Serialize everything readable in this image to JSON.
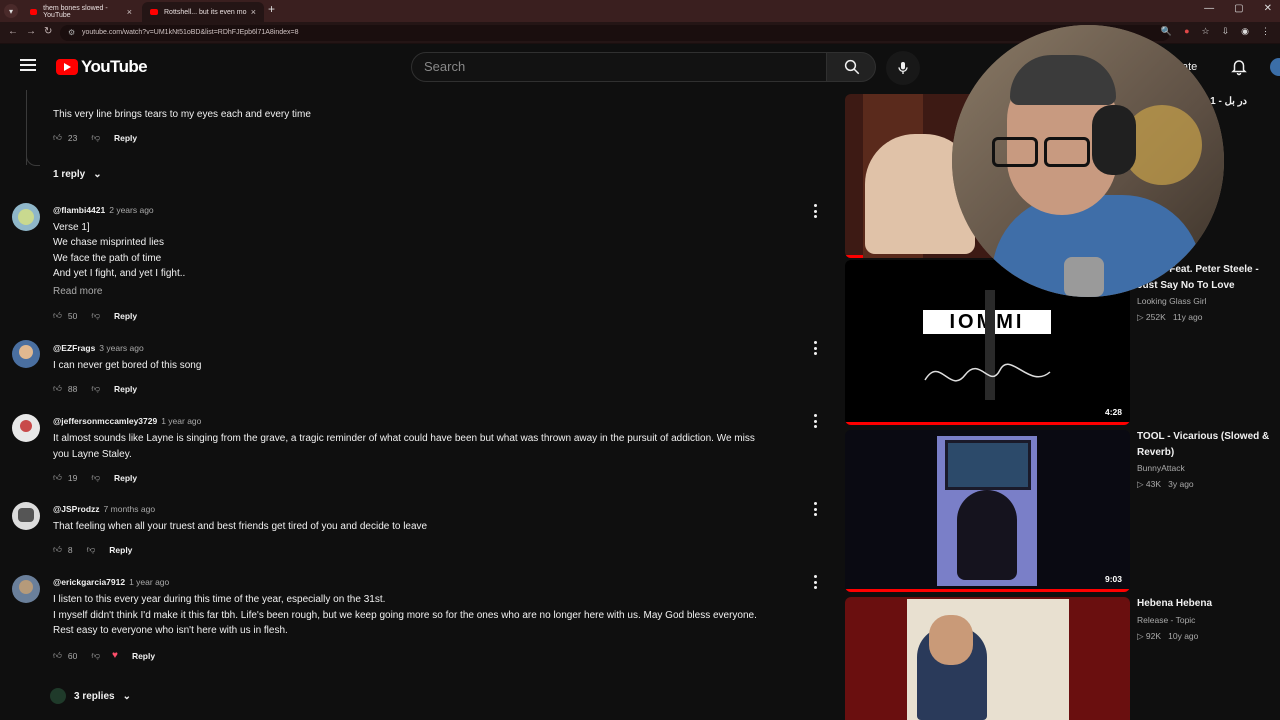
{
  "browser": {
    "tabs": [
      {
        "label": "them bones slowed - YouTube"
      },
      {
        "label": "Rottshell... but its even mo"
      }
    ],
    "url": "youtube.com/watch?v=UM1kNt51oBD&list=RDhFJEpb6l71A8index=8"
  },
  "header": {
    "logo_text": "YouTube",
    "search_placeholder": "Search",
    "create_label": "ate"
  },
  "comments": {
    "top_snippet": {
      "text": "This very line brings tears to my eyes each and every time",
      "likes": "23",
      "reply": "Reply",
      "replies_toggle": "1 reply"
    },
    "items": [
      {
        "author": "@flambi4421",
        "time": "2 years ago",
        "lines": [
          "Verse 1]",
          "We chase misprinted lies",
          "We face the path of time",
          "And yet I fight, and yet I fight.."
        ],
        "read_more": "Read more",
        "likes": "50",
        "reply": "Reply"
      },
      {
        "author": "@EZFrags",
        "time": "3 years ago",
        "lines": [
          "I can never get bored of this song"
        ],
        "likes": "88",
        "reply": "Reply"
      },
      {
        "author": "@jeffersonmccamley3729",
        "time": "1 year ago",
        "lines": [
          "It almost sounds like Layne is singing from the grave, a tragic reminder of what could have been but what was thrown away in the pursuit of addiction. We miss",
          "you Layne Staley."
        ],
        "likes": "19",
        "reply": "Reply"
      },
      {
        "author": "@JSProdzz",
        "time": "7 months ago",
        "lines": [
          "That feeling when all your truest and best friends get tired of you and decide to leave"
        ],
        "likes": "8",
        "reply": "Reply"
      },
      {
        "author": "@erickgarcia7912",
        "time": "1 year ago",
        "lines": [
          "I listen to this every year during this time of the year, especially on the 31st.",
          "I myself didn't think I'd make it this far tbh. Life's been rough, but we keep going more so for the ones who are no longer here with us. May God bless everyone.",
          "Rest easy to everyone who isn't here with us in flesh."
        ],
        "likes": "60",
        "reply": "Reply",
        "replies_toggle": "3 replies"
      }
    ]
  },
  "recommendations": [
    {
      "title": "Part 1 - در بل",
      "channel": "",
      "views": "",
      "age": "",
      "duration": ""
    },
    {
      "title": "Iommi Feat. Peter Steele - Just Say No To Love",
      "channel": "Looking Glass Girl",
      "views": "252K",
      "age": "11y ago",
      "duration": "4:28",
      "art_text": "IOMMI"
    },
    {
      "title": "TOOL - Vicarious (Slowed & Reverb)",
      "channel": "BunnyAttack",
      "views": "43K",
      "age": "3y ago",
      "duration": "9:03"
    },
    {
      "title": "Hebena Hebena",
      "channel": "Release - Topic",
      "views": "92K",
      "age": "10y ago",
      "duration": ""
    }
  ],
  "colors": {
    "accent": "#ff0000",
    "background": "#0f0f0f",
    "browser_frame": "#3a1f1f"
  }
}
